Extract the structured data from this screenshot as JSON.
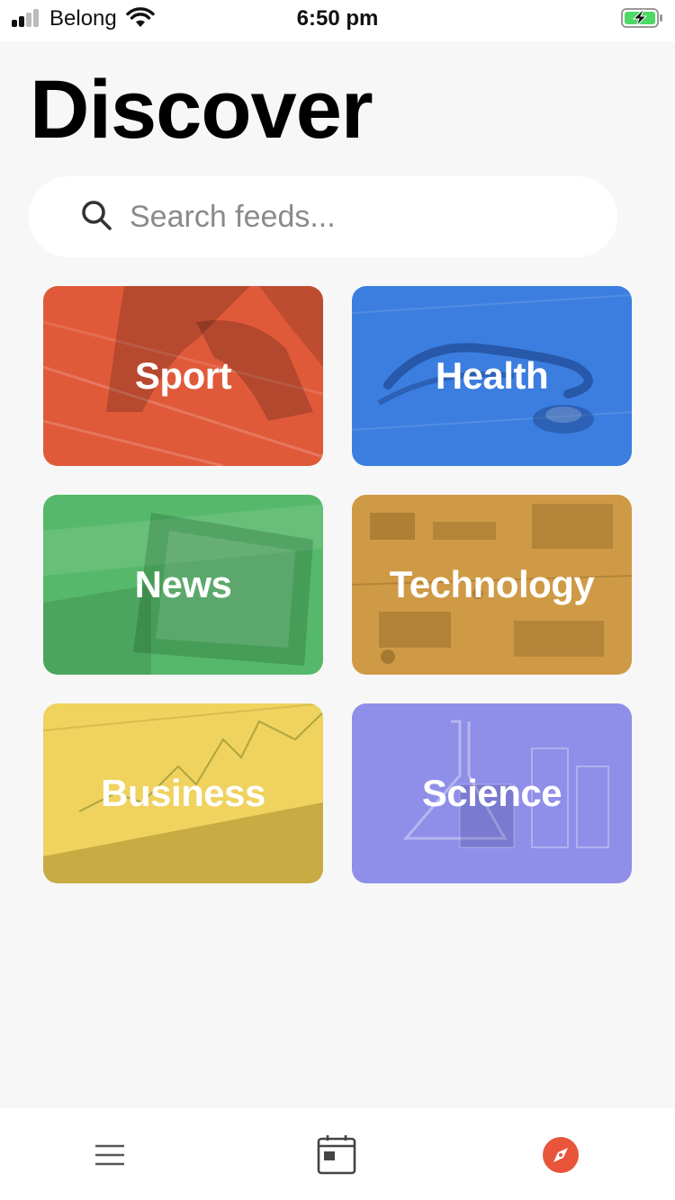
{
  "status_bar": {
    "carrier": "Belong",
    "time": "6:50 pm",
    "signal_bars_active": 2,
    "battery_charging": true
  },
  "page": {
    "title": "Discover"
  },
  "search": {
    "placeholder": "Search feeds..."
  },
  "categories": [
    {
      "label": "Sport",
      "color": "#e05a3a"
    },
    {
      "label": "Health",
      "color": "#3b7ee0"
    },
    {
      "label": "News",
      "color": "#56b86a"
    },
    {
      "label": "Technology",
      "color": "#cf9a45"
    },
    {
      "label": "Business",
      "color": "#f0d25e"
    },
    {
      "label": "Science",
      "color": "#8a8ae8"
    }
  ],
  "tab_bar": {
    "items": [
      {
        "icon": "menu-icon",
        "active": false
      },
      {
        "icon": "calendar-icon",
        "active": false
      },
      {
        "icon": "compass-icon",
        "active": true
      }
    ],
    "accent_color": "#e8553a"
  }
}
